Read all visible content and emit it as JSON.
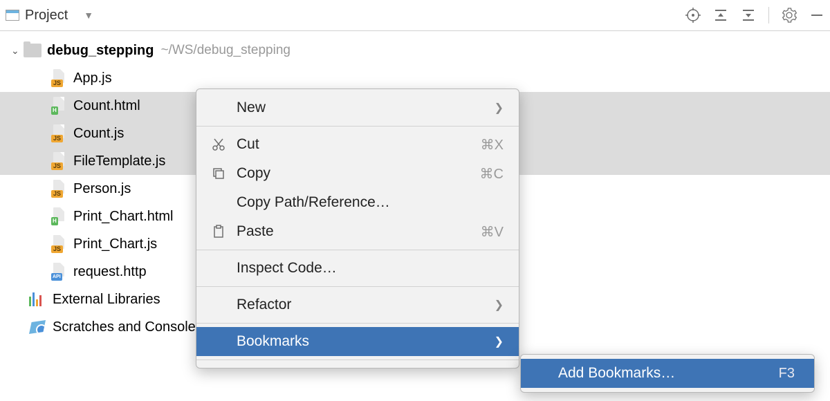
{
  "toolbar": {
    "project_label": "Project"
  },
  "tree": {
    "root": {
      "name": "debug_stepping",
      "path": "~/WS/debug_stepping"
    },
    "files": [
      {
        "name": "App.js",
        "type": "js"
      },
      {
        "name": "Count.html",
        "type": "html"
      },
      {
        "name": "Count.js",
        "type": "js"
      },
      {
        "name": "FileTemplate.js",
        "type": "js"
      },
      {
        "name": "Person.js",
        "type": "js"
      },
      {
        "name": "Print_Chart.html",
        "type": "html"
      },
      {
        "name": "Print_Chart.js",
        "type": "js"
      },
      {
        "name": "request.http",
        "type": "api"
      }
    ],
    "external_libraries": "External Libraries",
    "scratches": "Scratches and Consoles"
  },
  "context_menu": {
    "new": "New",
    "cut": {
      "label": "Cut",
      "shortcut": "⌘X"
    },
    "copy": {
      "label": "Copy",
      "shortcut": "⌘C"
    },
    "copy_path": "Copy Path/Reference…",
    "paste": {
      "label": "Paste",
      "shortcut": "⌘V"
    },
    "inspect": "Inspect Code…",
    "refactor": "Refactor",
    "bookmarks": "Bookmarks"
  },
  "submenu": {
    "add_bookmarks": {
      "label": "Add Bookmarks…",
      "shortcut": "F3"
    }
  }
}
